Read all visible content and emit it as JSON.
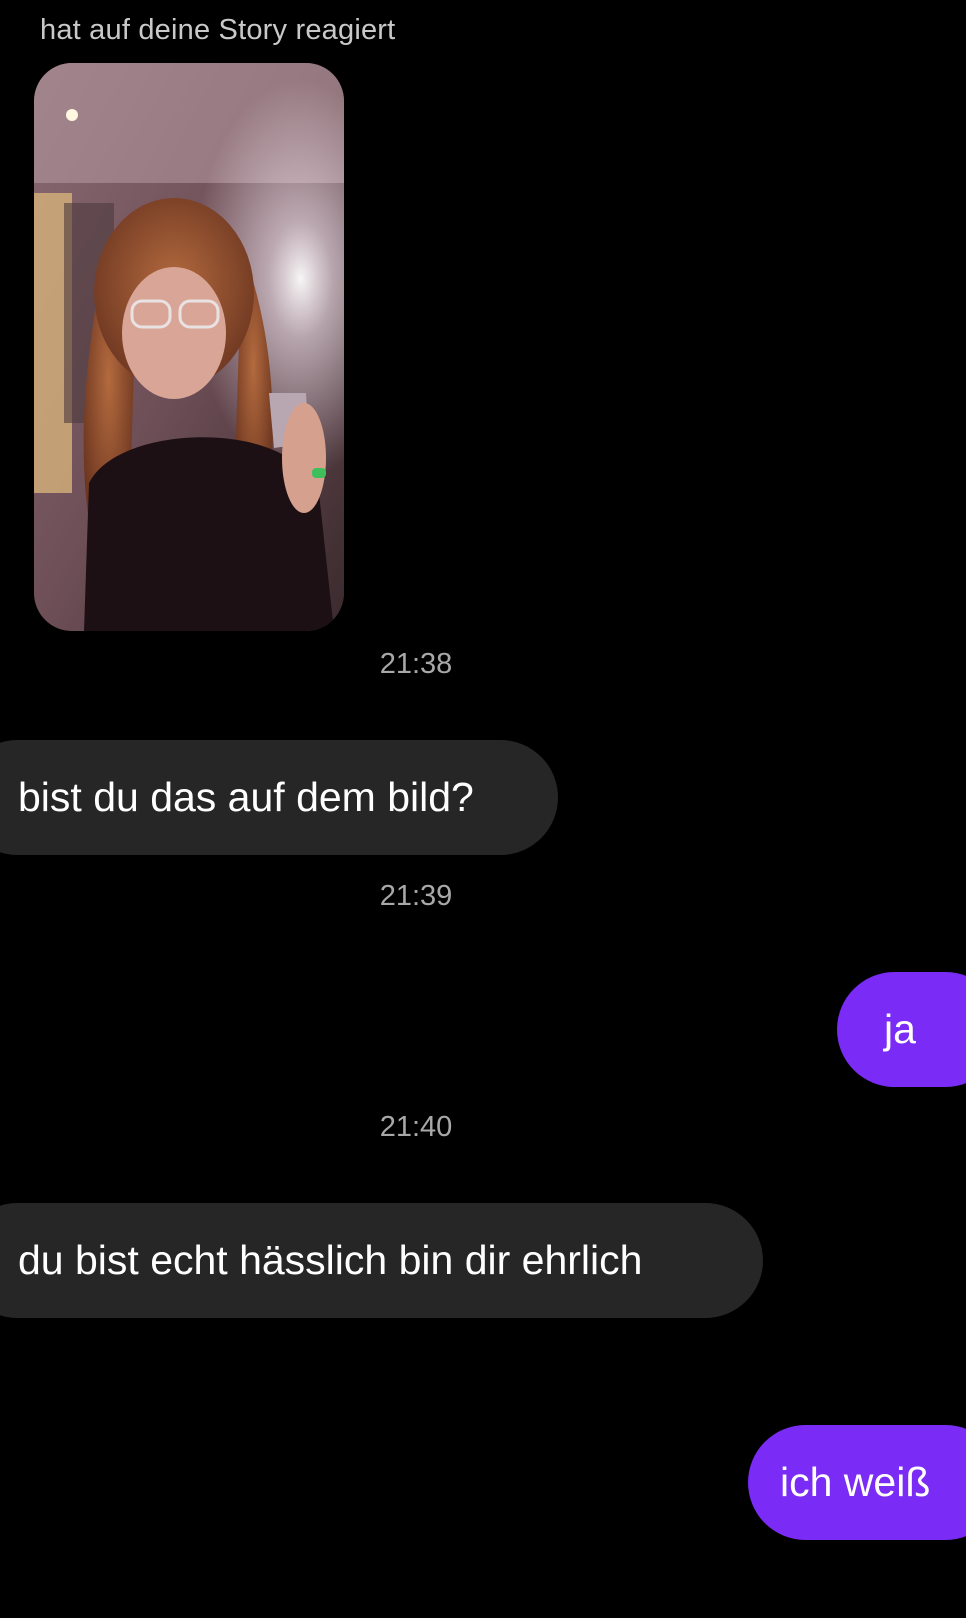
{
  "story_reaction": {
    "caption": "hat auf deine Story reagiert"
  },
  "colors": {
    "background": "#000000",
    "incoming_bubble": "#262626",
    "outgoing_bubble": "#7a2bf5",
    "timestamp_text": "#a8a8a8"
  },
  "messages": [
    {
      "kind": "timestamp",
      "text": "21:38"
    },
    {
      "kind": "incoming",
      "text": "bist du das auf dem bild?"
    },
    {
      "kind": "timestamp",
      "text": "21:39"
    },
    {
      "kind": "outgoing",
      "text": "ja"
    },
    {
      "kind": "timestamp",
      "text": "21:40"
    },
    {
      "kind": "incoming",
      "text": "du bist echt hässlich bin dir ehrlich"
    },
    {
      "kind": "outgoing",
      "text": "ich weiß"
    }
  ]
}
